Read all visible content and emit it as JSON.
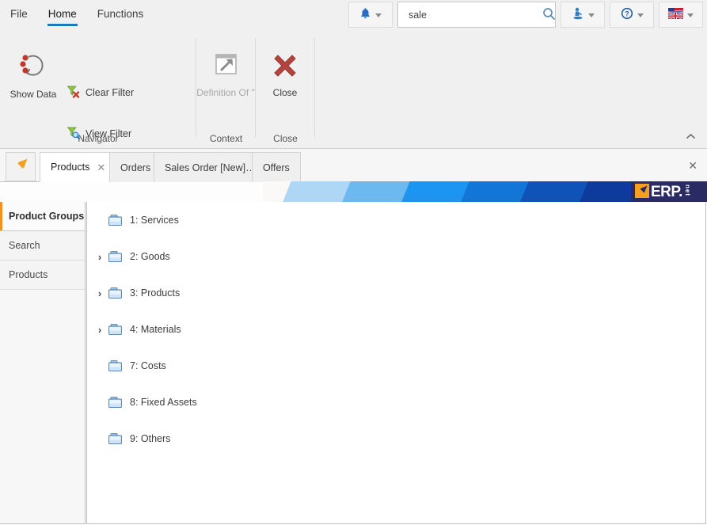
{
  "menu": {
    "items": [
      {
        "label": "File",
        "active": false
      },
      {
        "label": "Home",
        "active": true
      },
      {
        "label": "Functions",
        "active": false
      }
    ]
  },
  "toolbar": {
    "notifications_icon": "bell-icon",
    "user_icon": "user-icon",
    "help_icon": "help-icon",
    "language_icon": "flag-icon",
    "dropdown_icon": "chevron-down-icon"
  },
  "search": {
    "value": "sale",
    "placeholder": "",
    "icon": "search-icon"
  },
  "ribbon": {
    "collapse_icon": "chevron-up-icon",
    "groups": [
      {
        "label": "Navigator",
        "big_button": {
          "label": "Show Data",
          "icon": "refresh-data-icon",
          "disabled": false
        },
        "small_buttons": [
          {
            "label": "Clear Filter",
            "icon": "clear-filter-icon"
          },
          {
            "label": "View Filter",
            "icon": "view-filter-icon"
          }
        ]
      },
      {
        "label": "Context",
        "big_button": {
          "label": "Definition Of \"",
          "icon": "definition-of-icon",
          "disabled": true
        }
      },
      {
        "label": "Close",
        "big_button": {
          "label": "Close",
          "icon": "close-x-icon",
          "disabled": false
        }
      }
    ]
  },
  "tabstrip": {
    "home_icon": "expand-arrow-icon",
    "close_icon": "close-icon",
    "tabs": [
      {
        "label": "Products",
        "active": true,
        "closable": true
      },
      {
        "label": "Orders",
        "active": false,
        "closable": false
      },
      {
        "label": "Sales Order [New]…",
        "active": false,
        "closable": false
      },
      {
        "label": "Offers",
        "active": false,
        "closable": false
      }
    ]
  },
  "banner": {
    "logo_text": "ERP.",
    "logo_suffix": "net",
    "logo_icon": "erp-arrow-icon",
    "logo_bg": "#2b2b63",
    "accent": "#f0941f"
  },
  "sidebar": {
    "items": [
      {
        "label": "Product Groups",
        "active": true
      },
      {
        "label": "Search",
        "active": false
      },
      {
        "label": "Products",
        "active": false
      }
    ]
  },
  "tree": {
    "expand_icon": "chevron-right-icon",
    "folder_icon": "folder-icon",
    "rows": [
      {
        "label": "1: Services",
        "expandable": false
      },
      {
        "label": "2: Goods",
        "expandable": true
      },
      {
        "label": "3: Products",
        "expandable": true
      },
      {
        "label": "4: Materials",
        "expandable": true
      },
      {
        "label": "7: Costs",
        "expandable": false
      },
      {
        "label": "8: Fixed Assets",
        "expandable": false
      },
      {
        "label": "9: Others",
        "expandable": false
      }
    ]
  }
}
